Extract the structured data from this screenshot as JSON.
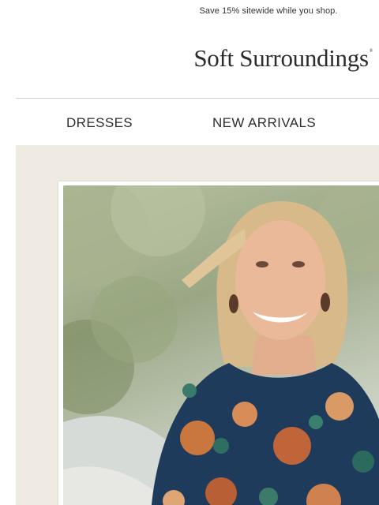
{
  "promo": {
    "text": "Save 15% sitewide while you shop."
  },
  "brand": {
    "name": "Soft Surroundings",
    "mark": "®",
    "color": "#2c2c2c"
  },
  "nav": {
    "items": [
      {
        "label": "DRESSES"
      },
      {
        "label": "NEW ARRIVALS"
      }
    ]
  },
  "hero": {
    "background_color": "#efebe3"
  }
}
